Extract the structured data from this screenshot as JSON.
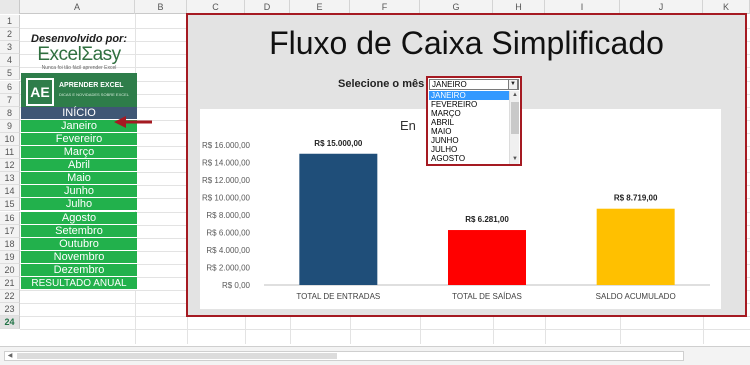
{
  "columns": [
    "A",
    "B",
    "C",
    "D",
    "E",
    "F",
    "G",
    "H",
    "I",
    "J",
    "K"
  ],
  "rows": [
    "1",
    "2",
    "3",
    "4",
    "5",
    "6",
    "7",
    "8",
    "9",
    "10",
    "11",
    "12",
    "13",
    "14",
    "15",
    "16",
    "17",
    "18",
    "19",
    "20",
    "21",
    "22",
    "23",
    "24"
  ],
  "active_row": "24",
  "left_panel": {
    "developed_by": "Desenvolvido por:",
    "logo_text": "ExcelΣasy",
    "logo_tagline": "Nunca foi tão fácil aprender Excel",
    "banner_badge": "AE",
    "banner_title": "APRENDER EXCEL",
    "banner_sub": "DICAS E NOVIDADES SOBRE EXCEL",
    "nav_items": [
      "INÍCIO",
      "Janeiro",
      "Fevereiro",
      "Março",
      "Abril",
      "Maio",
      "Junho",
      "Julho",
      "Agosto",
      "Setembro",
      "Outubro",
      "Novembro",
      "Dezembro",
      "RESULTADO ANUAL"
    ]
  },
  "dashboard": {
    "title": "Fluxo de Caixa Simplificado",
    "select_label": "Selecione o mês",
    "selected_month": "JANEIRO",
    "dropdown_options": [
      "JANEIRO",
      "FEVEREIRO",
      "MARÇO",
      "ABRIL",
      "MAIO",
      "JUNHO",
      "JULHO",
      "AGOSTO"
    ],
    "chart_title_partial": "En"
  },
  "colors": {
    "accent_border": "#a51a22",
    "nav_green": "#22b14c",
    "nav_inicio": "#3f5775",
    "bar_entradas": "#1f4e79",
    "bar_saidas": "#ff0000",
    "bar_saldo": "#ffc000"
  },
  "icons": {
    "dropdown_button": "chevron-down-icon",
    "nav_arrow": "arrow-left-icon"
  },
  "chart_data": {
    "type": "bar",
    "title": "",
    "categories": [
      "TOTAL DE ENTRADAS",
      "TOTAL DE SAÍDAS",
      "SALDO ACUMULADO"
    ],
    "values": [
      15000,
      6281,
      8719
    ],
    "data_labels": [
      "R$ 15.000,00",
      "R$ 6.281,00",
      "R$ 8.719,00"
    ],
    "colors": [
      "#1f4e79",
      "#ff0000",
      "#ffc000"
    ],
    "yticks": [
      "R$ 0,00",
      "R$ 2.000,00",
      "R$ 4.000,00",
      "R$ 6.000,00",
      "R$ 8.000,00",
      "R$ 10.000,00",
      "R$ 12.000,00",
      "R$ 14.000,00",
      "R$ 16.000,00"
    ],
    "ylim": [
      0,
      16000
    ],
    "grid": false,
    "legend": "none"
  }
}
